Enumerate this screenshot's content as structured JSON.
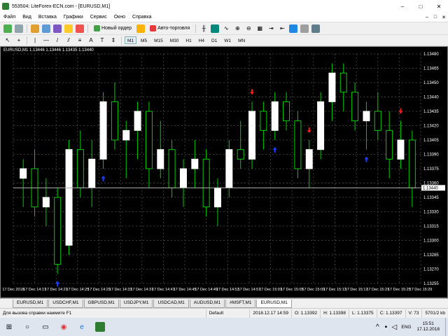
{
  "window": {
    "title": "553504: LiteForex-ECN.com - [EURUSD,M1]",
    "controls": [
      "–",
      "□",
      "✕"
    ]
  },
  "menu": {
    "items": [
      "Файл",
      "Вид",
      "Вставка",
      "Графики",
      "Сервис",
      "Окно",
      "Справка"
    ],
    "mdi_controls": [
      "–",
      "□",
      "✕"
    ]
  },
  "toolbar": {
    "new_order_label": "Новый ордер",
    "autotrading_label": "Авто-торговля",
    "timeframes": [
      "M1",
      "M5",
      "M15",
      "M30",
      "H1",
      "H4",
      "D1",
      "W1",
      "MN"
    ],
    "active_timeframe": "M1"
  },
  "chart": {
    "info": "EURUSD,M1  1.13446 1.13446 1.13435 1.13440",
    "colors": {
      "background": "#000000",
      "grid": "#3a3a3a",
      "bull": "#ffffff",
      "bear": "#000000",
      "wick": "#00cc00",
      "up_arrow": "#1e3cff",
      "down_arrow": "#ff1a1a",
      "price_line": "#b0b0b0"
    },
    "current_price_label": "1.13440",
    "price_labels": [
      "1.13480",
      "1.13465",
      "1.13450",
      "1.13440",
      "1.13435",
      "1.13420",
      "1.13405",
      "1.13390",
      "1.13375",
      "1.13360",
      "1.13345",
      "1.13330",
      "1.13315",
      "1.13300",
      "1.13285",
      "1.13270",
      "1.13255"
    ],
    "time_labels": [
      "17 Dec 2018",
      "17 Dec 14:17",
      "17 Dec 14:21",
      "17 Dec 14:25",
      "17 Dec 14:29",
      "17 Dec 14:33",
      "17 Dec 14:37",
      "17 Dec 14:41",
      "17 Dec 14:45",
      "17 Dec 14:49",
      "17 Dec 14:53",
      "17 Dec 14:57",
      "17 Dec 15:01",
      "17 Dec 15:05",
      "17 Dec 15:09",
      "17 Dec 15:13",
      "17 Dec 15:17",
      "17 Dec 15:21",
      "17 Dec 15:25",
      "17 Dec 15:29"
    ]
  },
  "chart_data": {
    "type": "candlestick",
    "symbol": "EURUSD",
    "timeframe": "M1",
    "ylim": [
      1.1326,
      1.135
    ],
    "candles": [
      [
        1.1337,
        1.1339,
        1.1334,
        1.1338
      ],
      [
        1.1338,
        1.134,
        1.1333,
        1.1334
      ],
      [
        1.1334,
        1.1337,
        1.1332,
        1.1335
      ],
      [
        1.1335,
        1.1336,
        1.1327,
        1.1328
      ],
      [
        1.133,
        1.1341,
        1.1329,
        1.134
      ],
      [
        1.134,
        1.1342,
        1.1335,
        1.1336
      ],
      [
        1.1336,
        1.1341,
        1.1334,
        1.1339
      ],
      [
        1.1339,
        1.1346,
        1.1338,
        1.1345
      ],
      [
        1.1345,
        1.1347,
        1.134,
        1.1341
      ],
      [
        1.1341,
        1.1343,
        1.1337,
        1.1342
      ],
      [
        1.1342,
        1.1345,
        1.1339,
        1.1344
      ],
      [
        1.1344,
        1.1345,
        1.1336,
        1.1338
      ],
      [
        1.1338,
        1.1343,
        1.1337,
        1.134
      ],
      [
        1.134,
        1.1341,
        1.1335,
        1.1336
      ],
      [
        1.1336,
        1.1339,
        1.1334,
        1.1338
      ],
      [
        1.1338,
        1.1341,
        1.1336,
        1.1339
      ],
      [
        1.1339,
        1.134,
        1.1333,
        1.1334
      ],
      [
        1.1334,
        1.1337,
        1.1332,
        1.1336
      ],
      [
        1.1336,
        1.1341,
        1.1335,
        1.134
      ],
      [
        1.134,
        1.1343,
        1.1338,
        1.1339
      ],
      [
        1.1339,
        1.1345,
        1.1338,
        1.1344
      ],
      [
        1.1344,
        1.1345,
        1.134,
        1.1342
      ],
      [
        1.1342,
        1.1346,
        1.1341,
        1.1345
      ],
      [
        1.1345,
        1.1346,
        1.1342,
        1.1343
      ],
      [
        1.1343,
        1.1344,
        1.1337,
        1.1338
      ],
      [
        1.1338,
        1.1341,
        1.1336,
        1.134
      ],
      [
        1.134,
        1.1346,
        1.1339,
        1.1345
      ],
      [
        1.1345,
        1.1349,
        1.1343,
        1.1348
      ],
      [
        1.1348,
        1.1349,
        1.1344,
        1.1346
      ],
      [
        1.1346,
        1.1347,
        1.1342,
        1.1343
      ],
      [
        1.1343,
        1.1345,
        1.134,
        1.1344
      ],
      [
        1.1344,
        1.1346,
        1.1341,
        1.1342
      ],
      [
        1.1342,
        1.1344,
        1.1337,
        1.1339
      ],
      [
        1.1339,
        1.1343,
        1.1338,
        1.1341
      ],
      [
        1.1341,
        1.1342,
        1.1334,
        1.1336
      ]
    ],
    "signals": [
      {
        "type": "buy",
        "candle": 3
      },
      {
        "type": "buy",
        "candle": 7
      },
      {
        "type": "sell",
        "candle": 20
      },
      {
        "type": "buy",
        "candle": 22
      },
      {
        "type": "sell",
        "candle": 25
      },
      {
        "type": "buy",
        "candle": 30
      },
      {
        "type": "sell",
        "candle": 33
      }
    ]
  },
  "tabs": {
    "items": [
      "EURUSD,M1",
      "USDCHF,M1",
      "GBPUSD,M1",
      "USDJPY,M1",
      "USDCAD,M1",
      "AUDUSD,M1",
      "#MSFT,M1",
      "EURUSD,M1"
    ],
    "active_index": 7
  },
  "status": {
    "help": "Для вызова справки нажмите F1",
    "profile": "Default",
    "datetime": "2018.12.17 14:59",
    "open": "O: 1.13392",
    "high": "H: 1.13398",
    "low": "L: 1.13375",
    "close": "C: 1.13397",
    "volume": "V: 73",
    "traffic": "5701/2 kb"
  },
  "taskbar": {
    "icons": [
      "windows-icon",
      "search-icon",
      "taskview-icon",
      "chrome-icon",
      "edge-icon",
      "metatrader-icon"
    ],
    "language": "ENG",
    "time": "15:51",
    "date": "17.12.2018"
  }
}
